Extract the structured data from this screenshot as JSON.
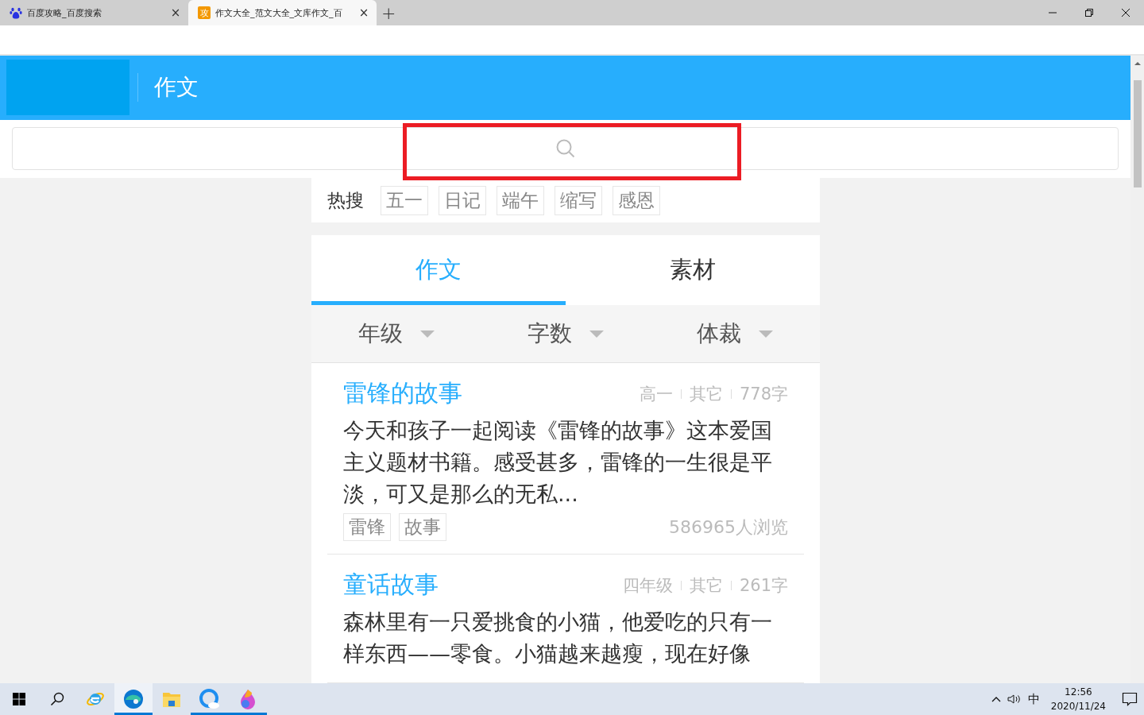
{
  "browser_tabs": [
    {
      "title": "百度攻略_百度搜索",
      "close": "×",
      "selected": false
    },
    {
      "title": "作文大全_范文大全_文库作文_百",
      "badge_text": "攻",
      "close": "×",
      "selected": true
    }
  ],
  "new_tab": "+",
  "header": {
    "title": "作文"
  },
  "search": {
    "highlighted": true
  },
  "hot_search": {
    "label": "热搜",
    "terms": [
      "五一",
      "日记",
      "端午",
      "缩写",
      "感恩"
    ]
  },
  "content_tabs": [
    {
      "label": "作文",
      "selected": true
    },
    {
      "label": "素材",
      "selected": false
    }
  ],
  "filters": [
    "年级",
    "字数",
    "体裁"
  ],
  "articles": [
    {
      "title": "雷锋的故事",
      "meta": [
        "高一",
        "其它",
        "778字"
      ],
      "excerpt": "今天和孩子一起阅读《雷锋的故事》这本爱国主义题材书籍。感受甚多，雷锋的一生很是平淡，可又是那么的无私...",
      "tags": [
        "雷锋",
        "故事"
      ],
      "views": "586965人浏览"
    },
    {
      "title": "童话故事",
      "meta": [
        "四年级",
        "其它",
        "261字"
      ],
      "excerpt": "森林里有一只爱挑食的小猫，他爱吃的只有一样东西——零食。小猫越来越瘦，现在好像"
    }
  ],
  "taskbar": {
    "apps": [
      {
        "kind": "ie",
        "active": false,
        "running": false
      },
      {
        "kind": "edge",
        "active": true,
        "running": true
      },
      {
        "kind": "folder",
        "active": false,
        "running": false
      },
      {
        "kind": "qq",
        "active": false,
        "running": true
      },
      {
        "kind": "paint",
        "active": false,
        "running": true
      }
    ],
    "ime": "中",
    "time": "12:56",
    "date": "2020/11/24"
  }
}
